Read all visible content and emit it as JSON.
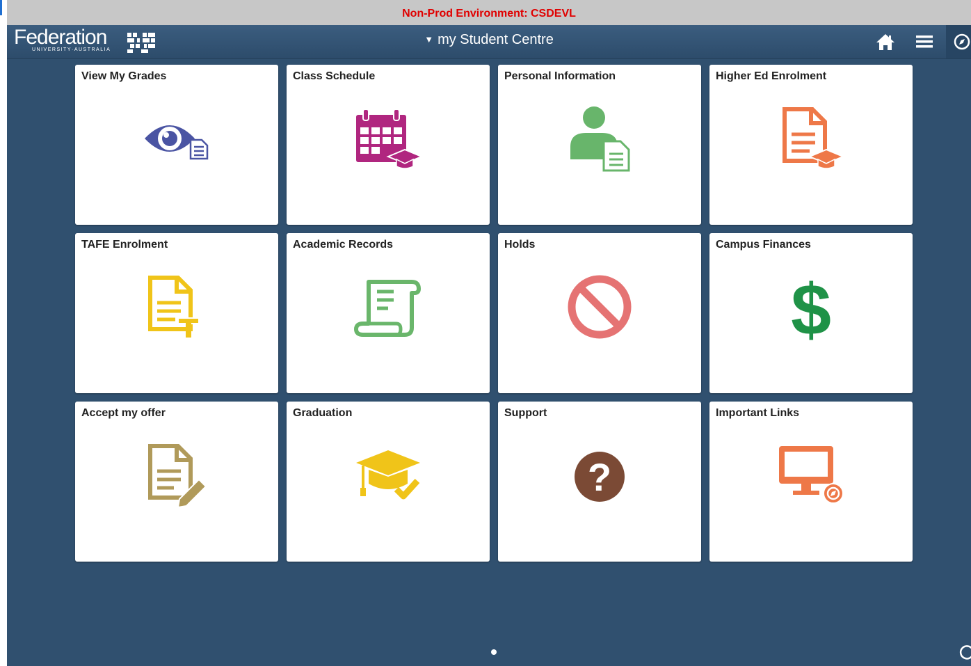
{
  "environment_banner": "Non-Prod Environment: CSDEVL",
  "header": {
    "logo_word": "Federation",
    "logo_subtitle": "UNIVERSITY·AUSTRALIA",
    "title": "my Student Centre",
    "icons": [
      "home-icon",
      "hamburger-menu-icon",
      "navigator-compass-icon"
    ]
  },
  "tiles": [
    {
      "label": "View My Grades",
      "icon": "eye-document-icon",
      "color": "#4a54a3"
    },
    {
      "label": "Class Schedule",
      "icon": "calendar-graduation-cap-icon",
      "color": "#b0267f"
    },
    {
      "label": "Personal Information",
      "icon": "person-document-icon",
      "color": "#68b56b"
    },
    {
      "label": "Higher Ed Enrolment",
      "icon": "document-graduation-cap-icon",
      "color": "#ee7848"
    },
    {
      "label": "TAFE Enrolment",
      "icon": "document-t-icon",
      "color": "#f0c419"
    },
    {
      "label": "Academic Records",
      "icon": "scroll-icon",
      "color": "#6ab66b"
    },
    {
      "label": "Holds",
      "icon": "prohibited-icon",
      "color": "#e57373"
    },
    {
      "label": "Campus Finances",
      "icon": "dollar-sign-icon",
      "color": "#1f9247"
    },
    {
      "label": "Accept my offer",
      "icon": "document-pencil-icon",
      "color": "#b09a5a"
    },
    {
      "label": "Graduation",
      "icon": "graduation-cap-check-icon",
      "color": "#f0c419"
    },
    {
      "label": "Support",
      "icon": "question-mark-icon",
      "color": "#7b4a35"
    },
    {
      "label": "Important Links",
      "icon": "monitor-compass-icon",
      "color": "#ee7848"
    }
  ],
  "pagination": {
    "pages": 1,
    "current": 1
  }
}
